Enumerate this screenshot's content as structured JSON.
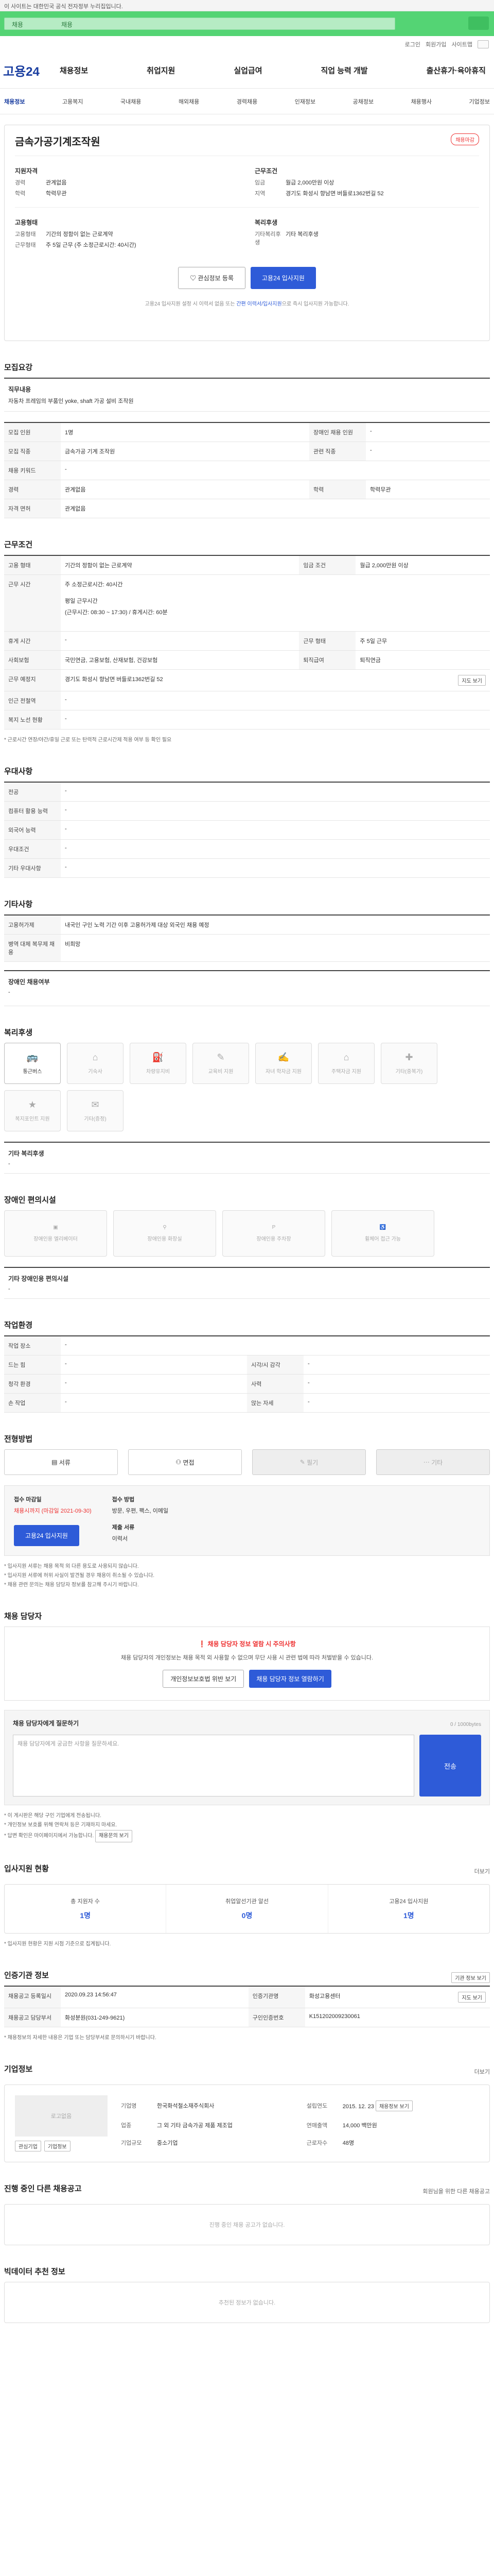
{
  "topbar": {
    "text": "이 사이트는 대한민국 공식 전자정부 누리집입니다."
  },
  "greenbar": {
    "label": "채용",
    "label2": "채용"
  },
  "util": {
    "items": [
      "로그인",
      "회원가입",
      "사이트맵"
    ]
  },
  "header": {
    "logo": "고용24",
    "nav": [
      "채용정보",
      "취업지원",
      "실업급여",
      "직업 능력 개발",
      "출산휴가·육아휴직"
    ]
  },
  "subnav": [
    "채용정보",
    "고용복지",
    "국내채용",
    "해외채용",
    "경력채용",
    "인재정보",
    "공채정보",
    "채용행사",
    "기업정보"
  ],
  "job": {
    "badge": "채용마감",
    "title": "금속가공기계조작원",
    "company": "",
    "work_cond_h": "근무조건",
    "qual_h": "지원자격",
    "qual": [
      {
        "k": "경력",
        "v": "관계없음"
      },
      {
        "k": "학력",
        "v": "학력무관"
      }
    ],
    "cond": [
      {
        "k": "임금",
        "v": "월급 2,000만원 이상"
      },
      {
        "k": "지역",
        "v": "경기도 화성시 향남면 버들로1362번길 52"
      }
    ],
    "emp_h": "고용형태",
    "wel_h": "복리후생",
    "emp": [
      {
        "k": "고용형태",
        "v": "기간의 정함이 없는 근로계약"
      },
      {
        "k": "근무형태",
        "v": "주 5일 근무 (주 소정근로시간: 40시간)"
      }
    ],
    "wel": [
      {
        "k": "기타복리후생",
        "v": "기타 복리후생"
      }
    ],
    "btn_wish": "관심정보 등록",
    "btn_apply": "고용24 입사지원",
    "note_pre": "고용24 입사지원 설정 시 이력서 없음 또는",
    "note_link": "간편 이력서/입사지원",
    "note_post": "으로 즉시 입사지원 가능합니다."
  },
  "recruit": {
    "h": "모집요강",
    "duty_h": "직무내용",
    "duty": "자동차 프레임의 부품인 yoke, shaft 가공 설비 조작원",
    "rows": [
      [
        "모집 인원",
        "1명",
        "장애인 채용 인원",
        "-"
      ],
      [
        "모집 직종",
        "금속가공 기계 조작원",
        "관련 직종",
        "-"
      ],
      [
        "채용 키워드",
        "-",
        "",
        ""
      ],
      [
        "경력",
        "관계없음",
        "학력",
        "학력무관"
      ],
      [
        "자격 면허",
        "관계없음",
        "",
        ""
      ]
    ]
  },
  "workcond": {
    "h": "근무조건",
    "rows": [
      [
        "고용 형태",
        "기간의 정함이 없는 근로계약",
        "임금 조건",
        "월급 2,000만원 이상"
      ]
    ],
    "hours_h": "근무 시간",
    "hours1": "주 소정근로시간: 40시간",
    "hours2": "평일 근무시간",
    "hours3": "(근무시간: 08:30 ~ 17:30) / 휴게시간: 60분",
    "rows2": [
      [
        "휴게 시간",
        "-",
        "근무 형태",
        "주 5일 근무"
      ],
      [
        "사회보험",
        "국민연금, 고용보험, 산재보험, 건강보험",
        "퇴직급여",
        "퇴직연금"
      ],
      [
        "근무 예정지",
        "경기도 화성시 향남면 버들로1362번길 52",
        "",
        ""
      ],
      [
        "인근 전철역",
        "-",
        "",
        ""
      ],
      [
        "복지 노선 현황",
        "-",
        "",
        ""
      ]
    ],
    "map_btn": "지도 보기",
    "note": "* 근로시간 연장/야간/휴일 근로 또는 탄력적 근로시간제 적용 여부 등 확인 필요"
  },
  "pref": {
    "h": "우대사항",
    "rows": [
      [
        "전공",
        "-"
      ],
      [
        "컴퓨터 활용 능력",
        "-"
      ],
      [
        "외국어 능력",
        "-"
      ],
      [
        "우대조건",
        "-"
      ],
      [
        "기타 우대사항",
        "-"
      ]
    ]
  },
  "other": {
    "h": "기타사항",
    "rows": [
      [
        "고용허가제",
        "내국인 구인 노력 기간 이후 고용허가제 대상 외국인 채용 예정"
      ],
      [
        "병역 대체 복무제 채용",
        "비희망"
      ]
    ],
    "disab_h": "장애인 채용여부",
    "disab": "-"
  },
  "welfare": {
    "h": "복리후생",
    "items": [
      {
        "label": "통근버스",
        "on": true
      },
      {
        "label": "기숙사",
        "on": false
      },
      {
        "label": "차량유지비",
        "on": false
      },
      {
        "label": "교육비 지원",
        "on": false
      },
      {
        "label": "자녀 학자금 지원",
        "on": false
      },
      {
        "label": "주택자금 지원",
        "on": false
      },
      {
        "label": "기타(중복가)",
        "on": false
      },
      {
        "label": "복지포인트 지원",
        "on": false
      },
      {
        "label": "기타(증정)",
        "on": false
      }
    ],
    "etc_h": "기타 복리후생",
    "etc": "-"
  },
  "disab": {
    "h": "장애인 편의시설",
    "items": [
      "장애인용 엘리베이터",
      "장애인용 화장실",
      "장애인용 주차장",
      "휠체어 접근 가능"
    ],
    "etc_h": "기타 장애인용 편의시설",
    "etc": "-"
  },
  "env": {
    "h": "작업환경",
    "rows": [
      [
        "작업 장소",
        "-",
        "",
        ""
      ],
      [
        "드는 힘",
        "-",
        "시각/시 감각",
        "-"
      ],
      [
        "청각 환경",
        "-",
        "사력",
        "-"
      ],
      [
        "손 작업",
        "-",
        "앉는 자세",
        "-"
      ]
    ]
  },
  "apply": {
    "h": "전형방법",
    "btns": [
      "서류",
      "면접",
      "필기",
      "기타"
    ],
    "period_h": "접수 마감일",
    "period": "채용시까지 (마감일 2021-09-30)",
    "method_h": "접수 방법",
    "method": "방문, 우편, 팩스, 이메일",
    "docs_h": "제출 서류",
    "docs": "이력서",
    "apply_btn": "고용24 입사지원",
    "notes": [
      "* 입사지원 서류는 채용 목적 외 다른 용도로 사용되지 않습니다.",
      "* 입사지원 서류에 허위 사실이 발견될 경우 채용이 취소될 수 있습니다.",
      "* 채용 관련 문의는 채용 담당자 정보를 참고해 주시기 바랍니다."
    ]
  },
  "contact": {
    "h": "채용 담당자",
    "warn": "채용 담당자 정보 열람 시 주의사항",
    "desc": "채용 담당자의 개인정보는 채용 목적 외 사용할 수 없으며 무단 사용 시 관련 법에 따라 처벌받을 수 있습니다.",
    "btn1": "개인정보보호법 위반 보기",
    "btn2": "채용 담당자 정보 열람하기",
    "inq_h": "채용 담당자에게 질문하기",
    "inq_hint": "채용 담당자에게 궁금한 사항을 질문하세요.",
    "inq_count": "0 / 1000bytes",
    "inq_btn": "전송",
    "inq_notes": [
      "* 이 게시판은 해당 구인 기업에게 전송됩니다.",
      "* 개인정보 보호를 위해 연락처 등은 기재하지 마세요.",
      "* 답변 확인은 마이페이지에서 가능합니다."
    ],
    "inq_btn2": "채용문의 보기"
  },
  "status": {
    "h": "입사지원 현황",
    "more": "더보기",
    "items": [
      {
        "t": "총 지원자 수",
        "n": "1명"
      },
      {
        "t": "취업알선기관 알선",
        "n": "0명"
      },
      {
        "t": "고용24 입사지원",
        "n": "1명"
      }
    ],
    "note": "* 입사지원 현황은 지원 시점 기준으로 집계됩니다."
  },
  "info": {
    "h": "인증기관 정보",
    "btn": "기관 정보 보기",
    "rows": [
      [
        "채용공고 등록일시",
        "2020.09.23 14:56:47",
        "인증기관명",
        "화성고용센터"
      ],
      [
        "채용공고 담당부서",
        "화성분원(031-249-9621)",
        "구인인증번호",
        "K151202009230061"
      ]
    ],
    "map": "지도 보기",
    "note": "* 채용정보의 자세한 내용은 기업 또는 담당부서로 문의하시기 바랍니다."
  },
  "corp": {
    "h": "기업정보",
    "more": "더보기",
    "logo": "로고없음",
    "btn1": "관심기업",
    "btn2": "기업정보",
    "rows": [
      [
        "기업명",
        "한국화석철소재주식회사",
        "설립연도",
        "2015. 12. 23"
      ],
      [
        "업종",
        "그 외 기타 금속가공 제품 제조업",
        "연매출액",
        "14,000 백만원"
      ],
      [
        "기업규모",
        "중소기업",
        "근로자수",
        "48명"
      ]
    ],
    "detail": "채용정보 보기"
  },
  "other_jobs": {
    "h": "진행 중인 다른 채용공고",
    "more": "회원님을 위한 다른 채용공고",
    "empty": "진행 중인 채용 공고가 없습니다."
  },
  "recommend": {
    "h": "빅데이터 추천 정보",
    "empty": "추천된 정보가 없습니다."
  }
}
